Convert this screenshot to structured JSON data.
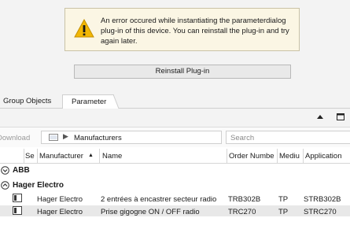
{
  "error": {
    "message": "An error occured while instantiating the parameterdialog plug-in of this device. You can reinstall the plug-in and try again later.",
    "line1": "An error occured while instantiating the parameterdialog",
    "line2": "plug-in of this device. You can reinstall the plug-in and try",
    "line3": "again later.",
    "icon": "warning-icon"
  },
  "reinstall_button": "Reinstall Plug-in",
  "tabs": [
    {
      "label": "Group Objects",
      "active": false
    },
    {
      "label": "Parameter",
      "active": true
    }
  ],
  "toolbar": {
    "download_label": "Download",
    "path": "Manufacturers",
    "search_placeholder": "Search"
  },
  "table": {
    "columns": {
      "se": "Se",
      "manufacturer": "Manufacturer",
      "sort_indicator": "▲",
      "name": "Name",
      "order_number": "Order Numbe",
      "medium": "Mediu",
      "application": "Application"
    },
    "groups": [
      {
        "name": "ABB",
        "expanded": false,
        "rows": []
      },
      {
        "name": "Hager Electro",
        "expanded": true,
        "rows": [
          {
            "manufacturer": "Hager Electro",
            "name": "2 entrées à encastrer secteur radio",
            "order_number": "TRB302B",
            "medium": "TP",
            "application": "STRB302B"
          },
          {
            "manufacturer": "Hager Electro",
            "name": "Prise gigogne ON / OFF radio",
            "order_number": "TRC270",
            "medium": "TP",
            "application": "STRC270"
          }
        ]
      }
    ]
  },
  "colors": {
    "warning": "#f2b705",
    "panel_bg": "#fbf6e4",
    "selected_row": "#e8e8e8"
  }
}
